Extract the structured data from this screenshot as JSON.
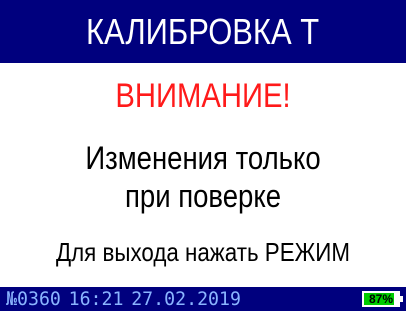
{
  "header": {
    "title": "КАЛИБРОВКА Т"
  },
  "content": {
    "warning": "ВНИМАНИЕ!",
    "message_line1": "Изменения только",
    "message_line2": "при поверке",
    "exit_hint": "Для выхода нажать РЕЖИМ"
  },
  "status_bar": {
    "device_number": "№0360",
    "time": "16:21",
    "date": "27.02.2019",
    "battery_label": "87%",
    "battery_level": 0.87
  },
  "colors": {
    "header_bg": "#00007e",
    "warning": "#ff1a1a",
    "status_text": "#8ab4ff",
    "battery_fill": "#00cc00"
  },
  "icons": {
    "battery": "battery-icon"
  }
}
